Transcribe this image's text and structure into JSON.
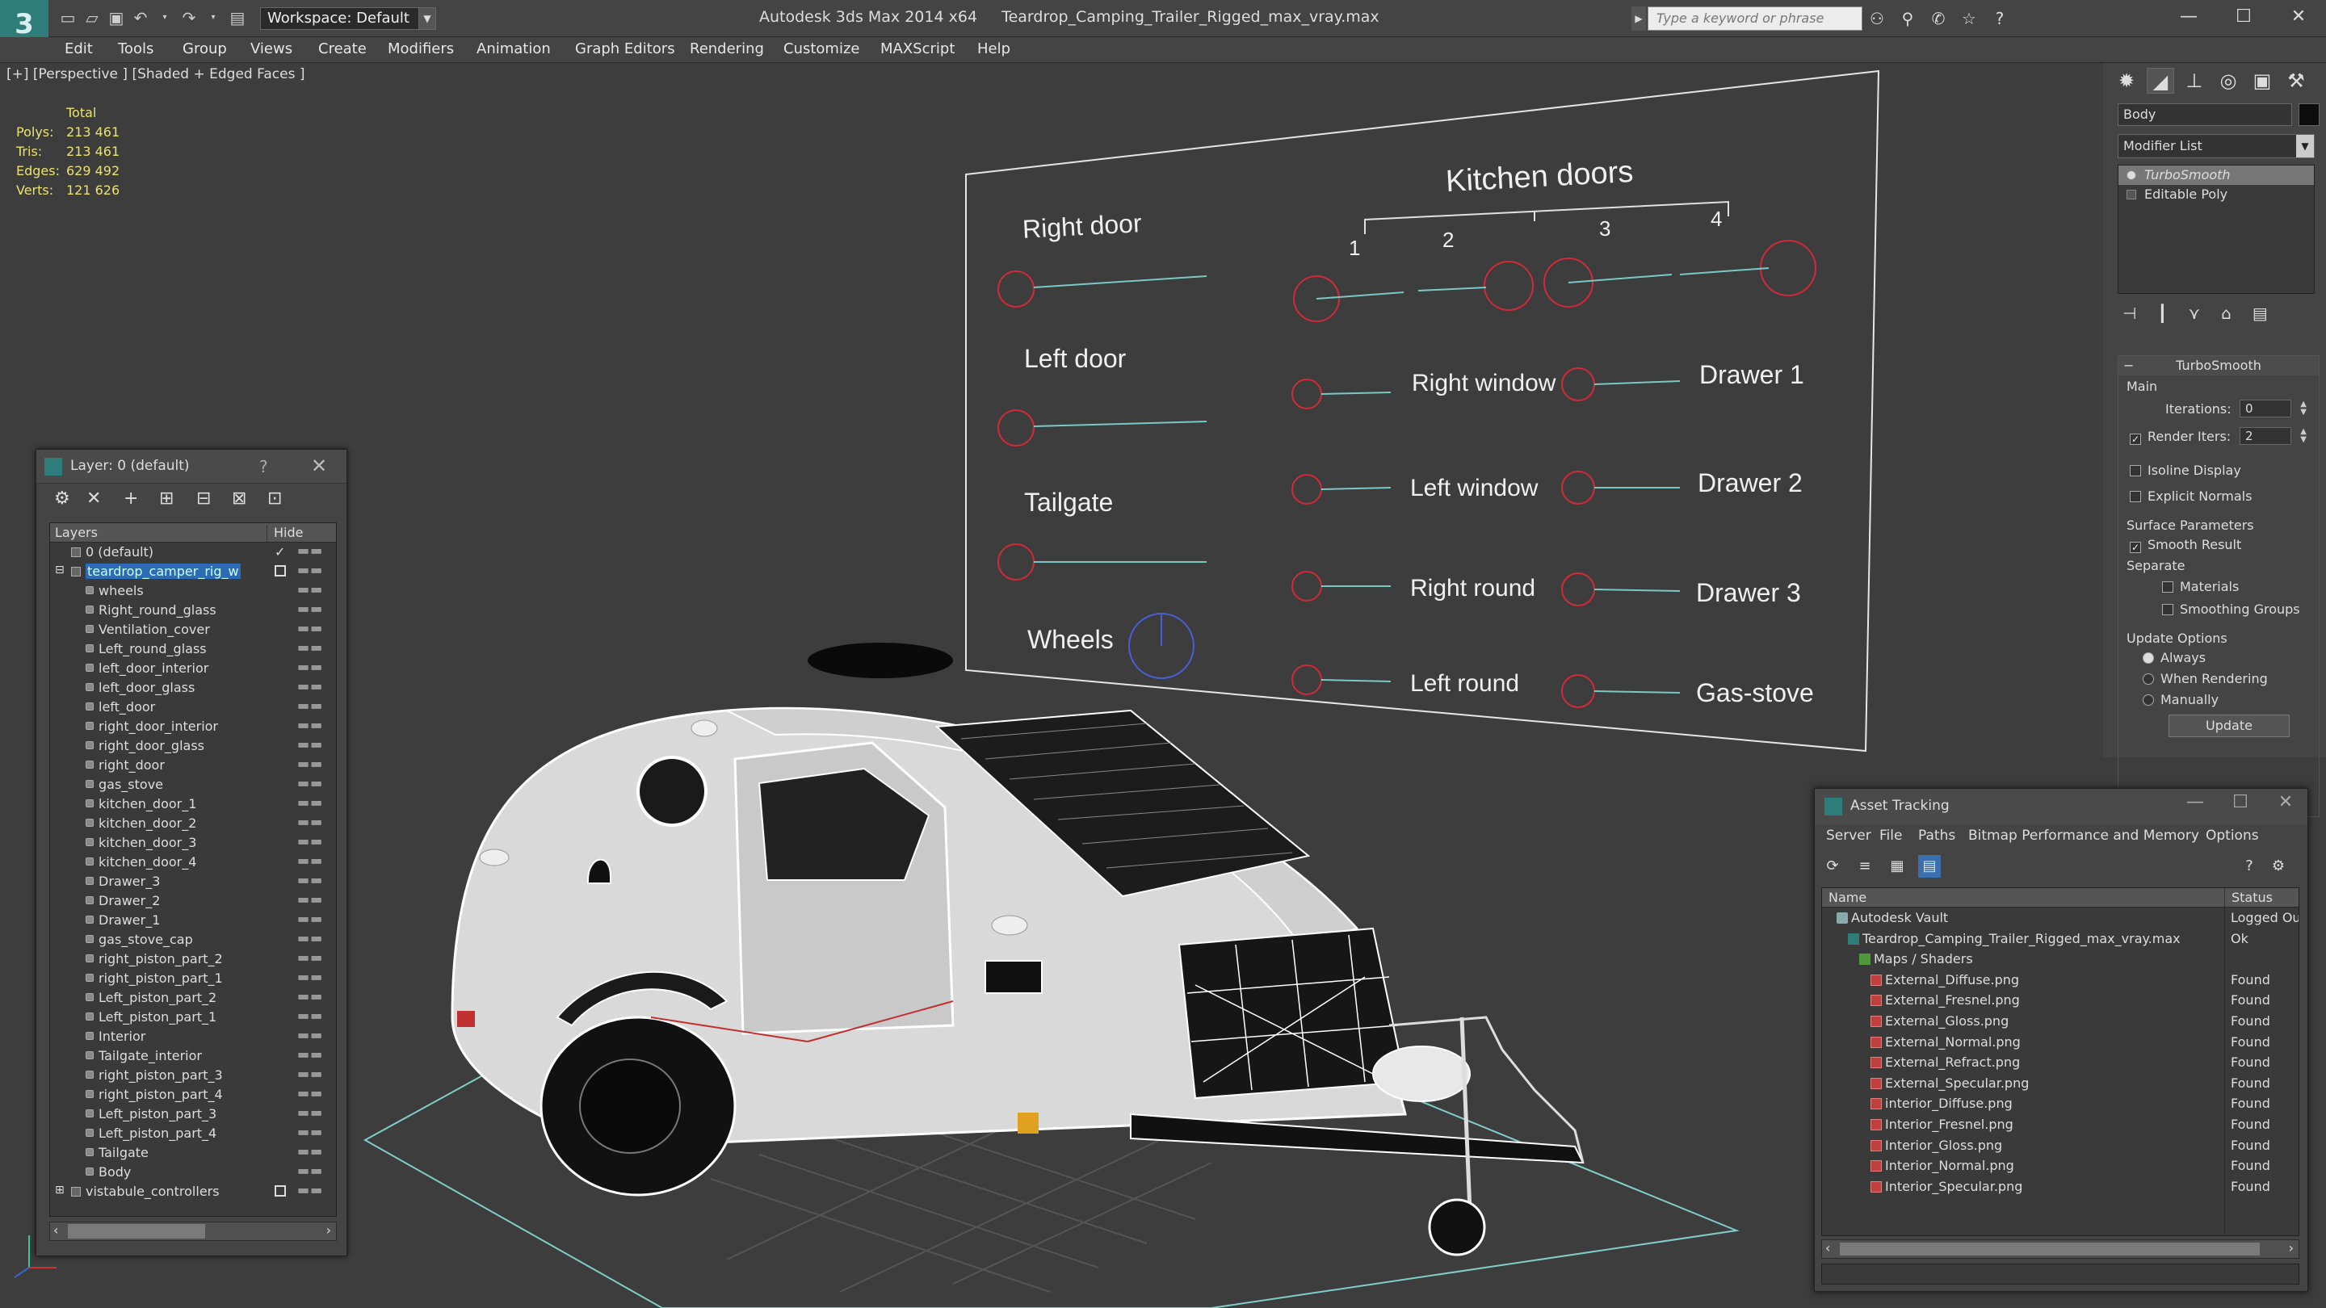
{
  "app": {
    "title": "Autodesk 3ds Max 2014 x64     Teardrop_Camping_Trailer_Rigged_max_vray.max",
    "workspace": "Workspace: Default",
    "search_placeholder": "Type a keyword or phrase"
  },
  "menu": [
    "Edit",
    "Tools",
    "Group",
    "Views",
    "Create",
    "Modifiers",
    "Animation",
    "Graph Editors",
    "Rendering",
    "Customize",
    "MAXScript",
    "Help"
  ],
  "viewport": {
    "label": "[+] [Perspective ] [Shaded + Edged Faces ]",
    "stats": {
      "header": "Total",
      "rows": [
        {
          "k": "Polys:",
          "v": "213 461"
        },
        {
          "k": "Tris:",
          "v": "213 461"
        },
        {
          "k": "Edges:",
          "v": "629 492"
        },
        {
          "k": "Verts:",
          "v": "121 626"
        }
      ]
    },
    "board": {
      "kitchen_doors": "Kitchen doors",
      "kd_numbers": [
        "1",
        "2",
        "3",
        "4"
      ],
      "right_door": "Right door",
      "left_door": "Left door",
      "tailgate": "Tailgate",
      "wheels": "Wheels",
      "right_window": "Right window",
      "left_window": "Left window",
      "right_round": "Right round",
      "left_round": "Left round",
      "drawer1": "Drawer 1",
      "drawer2": "Drawer 2",
      "drawer3": "Drawer 3",
      "gas_stove": "Gas-stove"
    }
  },
  "layer_panel": {
    "title": "Layer: 0 (default)",
    "help": "?",
    "col_layers": "Layers",
    "col_hide": "Hide",
    "default_layer": "0 (default)",
    "selected_layer": "teardrop_camper_rig_w",
    "objects": [
      "wheels",
      "Right_round_glass",
      "Ventilation_cover",
      "Left_round_glass",
      "left_door_interior",
      "left_door_glass",
      "left_door",
      "right_door_interior",
      "right_door_glass",
      "right_door",
      "gas_stove",
      "kitchen_door_1",
      "kitchen_door_2",
      "kitchen_door_3",
      "kitchen_door_4",
      "Drawer_3",
      "Drawer_2",
      "Drawer_1",
      "gas_stove_cap",
      "right_piston_part_2",
      "right_piston_part_1",
      "Left_piston_part_2",
      "Left_piston_part_1",
      "Interior",
      "Tailgate_interior",
      "right_piston_part_3",
      "right_piston_part_4",
      "Left_piston_part_3",
      "Left_piston_part_4",
      "Tailgate",
      "Body"
    ],
    "last_layer": "vistabule_controllers"
  },
  "command_panel": {
    "object_name": "Body",
    "modifier_list": "Modifier List",
    "stack": [
      "TurboSmooth",
      "Editable Poly"
    ],
    "rollout_title": "TurboSmooth",
    "main": "Main",
    "iterations_label": "Iterations:",
    "iterations_value": "0",
    "render_iters_label": "Render Iters:",
    "render_iters_value": "2",
    "isoline": "Isoline Display",
    "explicit_normals": "Explicit Normals",
    "surface_params": "Surface Parameters",
    "smooth_result": "Smooth Result",
    "separate": "Separate",
    "materials": "Materials",
    "smoothing_groups": "Smoothing Groups",
    "update_options": "Update Options",
    "always": "Always",
    "when_rendering": "When Rendering",
    "manually": "Manually",
    "update": "Update"
  },
  "asset_tracking": {
    "title": "Asset Tracking",
    "menu": [
      "Server",
      "File",
      "Paths",
      "Bitmap Performance and Memory",
      "Options"
    ],
    "col_name": "Name",
    "col_status": "Status",
    "rows": [
      {
        "name": "Autodesk Vault",
        "status": "Logged Out",
        "kind": "vault",
        "indent": 1
      },
      {
        "name": "Teardrop_Camping_Trailer_Rigged_max_vray.max",
        "status": "Ok",
        "kind": "max",
        "indent": 2
      },
      {
        "name": "Maps / Shaders",
        "status": "",
        "kind": "map",
        "indent": 3
      },
      {
        "name": "External_Diffuse.png",
        "status": "Found",
        "kind": "png",
        "indent": 4
      },
      {
        "name": "External_Fresnel.png",
        "status": "Found",
        "kind": "png",
        "indent": 4
      },
      {
        "name": "External_Gloss.png",
        "status": "Found",
        "kind": "png",
        "indent": 4
      },
      {
        "name": "External_Normal.png",
        "status": "Found",
        "kind": "png",
        "indent": 4
      },
      {
        "name": "External_Refract.png",
        "status": "Found",
        "kind": "png",
        "indent": 4
      },
      {
        "name": "External_Specular.png",
        "status": "Found",
        "kind": "png",
        "indent": 4
      },
      {
        "name": "interior_Diffuse.png",
        "status": "Found",
        "kind": "png",
        "indent": 4
      },
      {
        "name": "Interior_Fresnel.png",
        "status": "Found",
        "kind": "png",
        "indent": 4
      },
      {
        "name": "Interior_Gloss.png",
        "status": "Found",
        "kind": "png",
        "indent": 4
      },
      {
        "name": "Interior_Normal.png",
        "status": "Found",
        "kind": "png",
        "indent": 4
      },
      {
        "name": "Interior_Specular.png",
        "status": "Found",
        "kind": "png",
        "indent": 4
      }
    ]
  }
}
